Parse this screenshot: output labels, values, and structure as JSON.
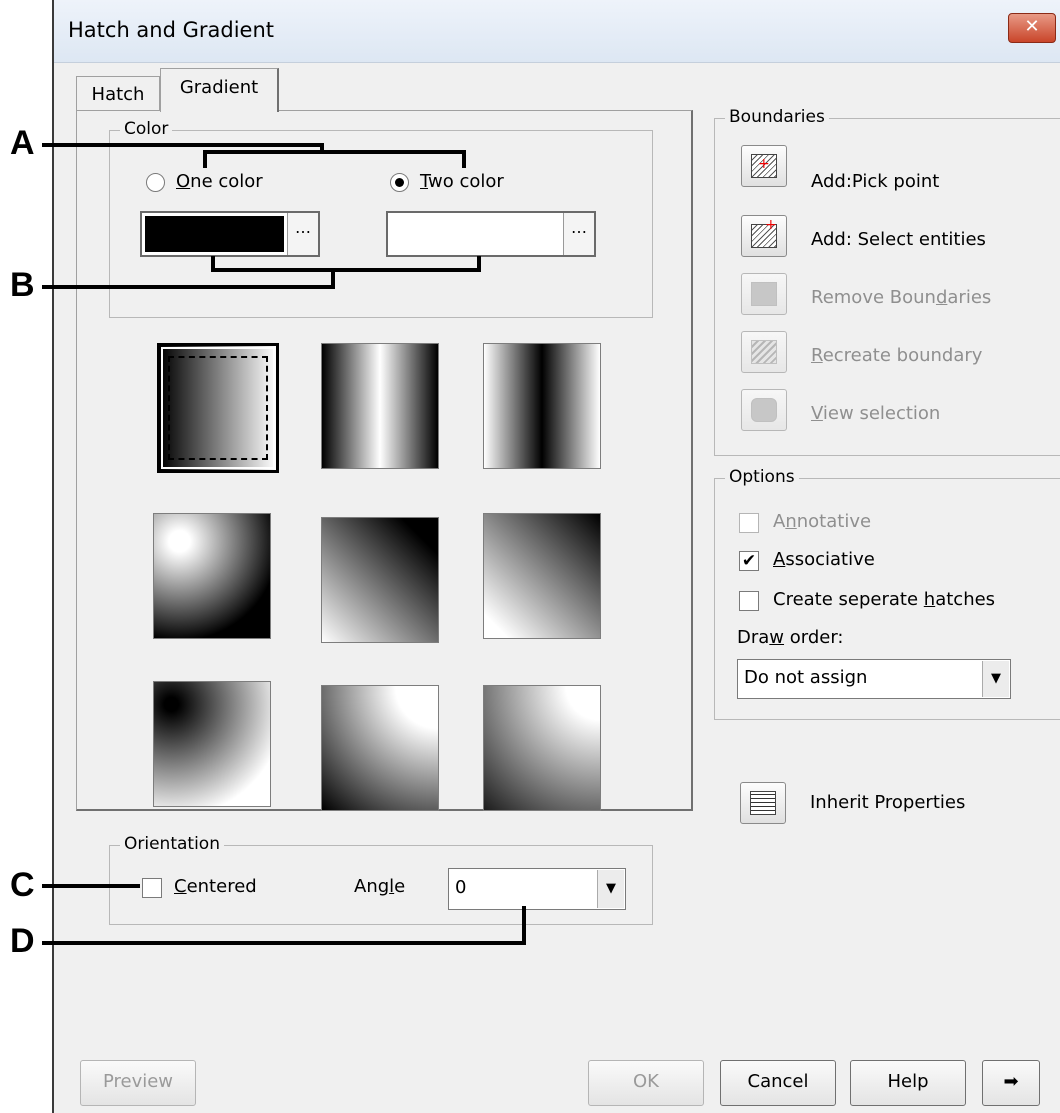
{
  "window": {
    "title": "Hatch and Gradient",
    "close_glyph": "✕"
  },
  "tabs": [
    {
      "label": "Hatch"
    },
    {
      "label": "Gradient"
    }
  ],
  "color": {
    "legend": "Color",
    "one_color": {
      "prefix": "",
      "mnemonic": "O",
      "rest": "ne color",
      "selected": false
    },
    "two_color": {
      "prefix": "",
      "mnemonic": "T",
      "rest": "wo color",
      "selected": true
    },
    "color1": "#000000",
    "color2": "#ffffff",
    "browse": "…"
  },
  "patterns": [
    {
      "name": "linear-centered",
      "selected": true
    },
    {
      "name": "cylinder"
    },
    {
      "name": "inverted-cylinder"
    },
    {
      "name": "spherical-corner"
    },
    {
      "name": "diagonal-dark-top"
    },
    {
      "name": "diagonal-light-bottom"
    },
    {
      "name": "inverted-spherical-corner"
    },
    {
      "name": "curved-dark-bottom"
    },
    {
      "name": "curved-dark-bottom-right"
    }
  ],
  "orientation": {
    "legend": "Orientation",
    "centered": {
      "mnemonic": "C",
      "rest": "entered",
      "checked": false
    },
    "angle_label_pre": "Ang",
    "angle_mnemonic": "l",
    "angle_label_post": "e",
    "angle_value": "0"
  },
  "boundaries": {
    "legend": "Boundaries",
    "items": [
      {
        "icon": "pick-point-icon",
        "label_pre": "Add:Pick point",
        "mnemonic": "",
        "label_post": "",
        "enabled": true
      },
      {
        "icon": "select-entities-icon",
        "label_pre": "Add: Select entities",
        "mnemonic": "",
        "label_post": "",
        "enabled": true
      },
      {
        "icon": "remove-boundaries-icon",
        "label_pre": "Remove Boun",
        "mnemonic": "d",
        "label_post": "aries",
        "enabled": false
      },
      {
        "icon": "recreate-boundary-icon",
        "label_pre": "",
        "mnemonic": "R",
        "label_post": "ecreate boundary",
        "enabled": false
      },
      {
        "icon": "view-selection-icon",
        "label_pre": "",
        "mnemonic": "V",
        "label_post": "iew selection",
        "enabled": false
      }
    ]
  },
  "options": {
    "legend": "Options",
    "annotative": {
      "pre": "A",
      "mnemonic": "n",
      "post": "notative",
      "checked": false,
      "enabled": false
    },
    "associative": {
      "pre": "",
      "mnemonic": "A",
      "post": "ssociative",
      "checked": true,
      "enabled": true
    },
    "separate": {
      "pre": "Create seperate ",
      "mnemonic": "h",
      "post": "atches",
      "checked": false,
      "enabled": true
    },
    "draw_order_pre": "Dra",
    "draw_order_mnemonic": "w",
    "draw_order_post": " order:",
    "draw_order_value": "Do not assign"
  },
  "inherit": {
    "label": "Inherit Properties"
  },
  "buttons": {
    "preview": "Preview",
    "ok": "OK",
    "cancel": "Cancel",
    "help": "Help",
    "more": "➡"
  },
  "callouts": [
    "A",
    "B",
    "C",
    "D"
  ]
}
